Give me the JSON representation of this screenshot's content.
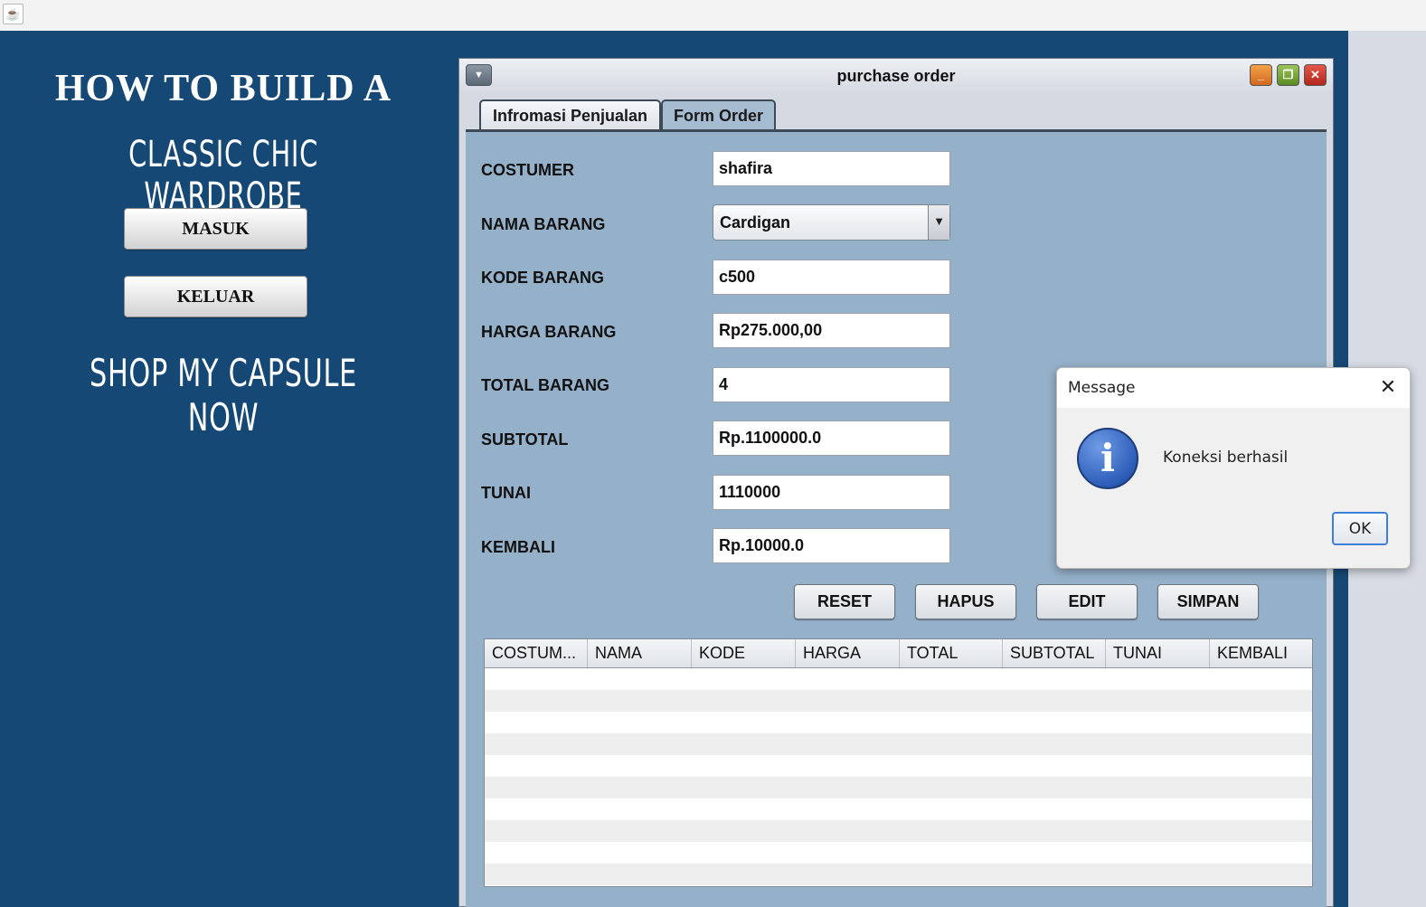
{
  "window": {
    "java_icon": "java-cup-icon"
  },
  "promo": {
    "heading1": "HOW TO BUILD A",
    "heading2": "CLASSIC CHIC WARDROBE",
    "masuk_label": "MASUK",
    "keluar_label": "KELUAR",
    "tagline": "SHOP MY CAPSULE NOW"
  },
  "frame": {
    "title": "purchase order",
    "tabs": [
      {
        "label": "Infromasi Penjualan",
        "selected": false
      },
      {
        "label": "Form Order",
        "selected": true
      }
    ]
  },
  "form": {
    "costumer": {
      "label": "COSTUMER",
      "value": "shafira"
    },
    "nama_barang": {
      "label": "NAMA BARANG",
      "value": "Cardigan"
    },
    "kode_barang": {
      "label": "KODE BARANG",
      "value": "c500"
    },
    "harga_barang": {
      "label": "HARGA BARANG",
      "value": "Rp275.000,00"
    },
    "total_barang": {
      "label": "TOTAL BARANG",
      "value": "4"
    },
    "subtotal": {
      "label": "SUBTOTAL",
      "value": "Rp.1100000.0"
    },
    "tunai": {
      "label": "TUNAI",
      "value": "1110000"
    },
    "kembali": {
      "label": "KEMBALI",
      "value": "Rp.10000.0"
    }
  },
  "buttons": {
    "reset": "RESET",
    "hapus": "HAPUS",
    "edit": "EDIT",
    "simpan": "SIMPAN"
  },
  "table": {
    "columns": [
      "COSTUM...",
      "NAMA",
      "KODE",
      "HARGA",
      "TOTAL",
      "SUBTOTAL",
      "TUNAI",
      "KEMBALI"
    ],
    "rows": []
  },
  "dialog": {
    "title": "Message",
    "message": "Koneksi berhasil",
    "ok_label": "OK",
    "icon": "information-icon"
  },
  "colors": {
    "background_blue": "#164876",
    "panel_blue": "#95b0c9",
    "dialog_bg": "#f0f0f0"
  }
}
